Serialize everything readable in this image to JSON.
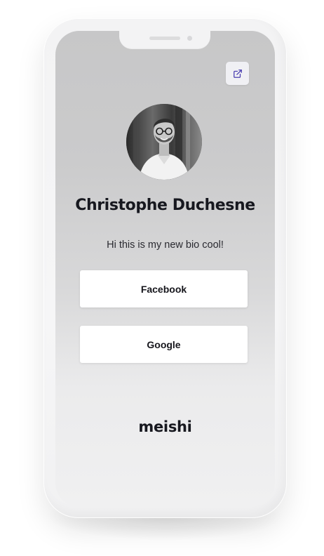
{
  "profile": {
    "name": "Christophe Duchesne",
    "bio": "Hi this is my new bio cool!"
  },
  "links": [
    {
      "label": "Facebook"
    },
    {
      "label": "Google"
    }
  ],
  "footer": {
    "brand": "meishi"
  },
  "icons": {
    "share": "external-link-icon"
  },
  "colors": {
    "share_icon": "#4b3fb0",
    "text_dark": "#17181f",
    "button_bg": "#ffffff"
  }
}
